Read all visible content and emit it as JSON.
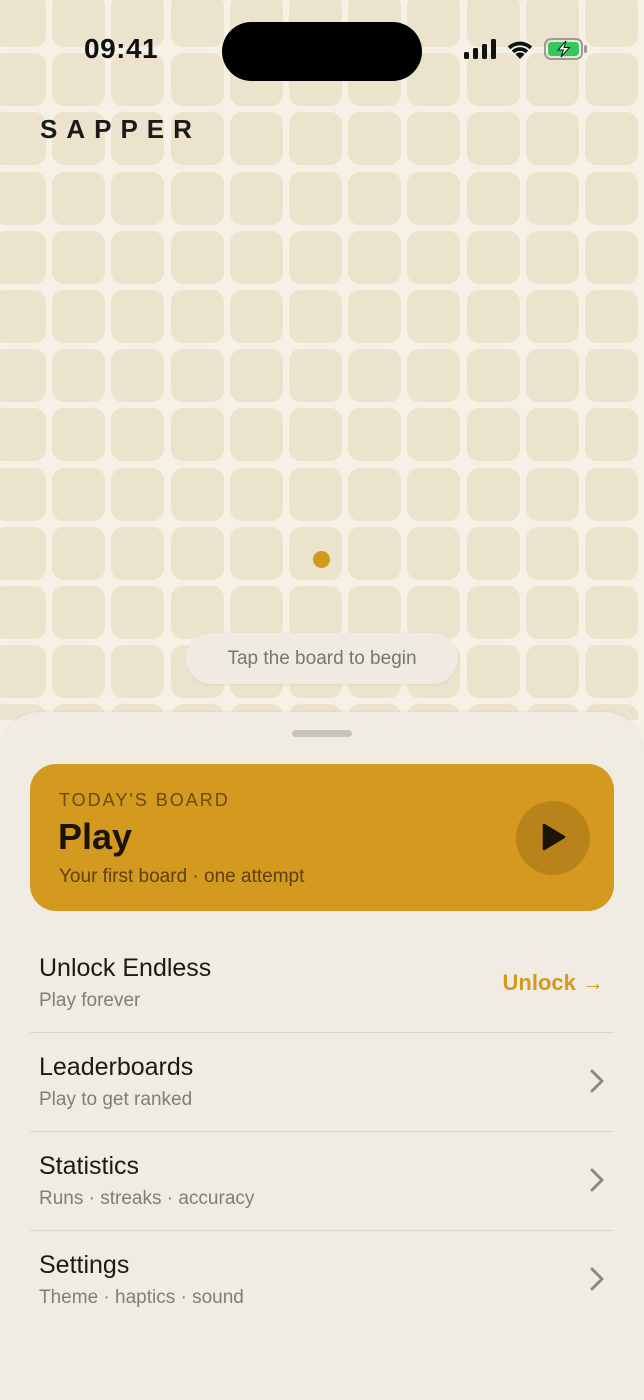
{
  "status_bar": {
    "time": "09:41",
    "icons": [
      "signal-icon",
      "wifi-icon",
      "battery-charging-icon"
    ],
    "battery_color": "#34c759"
  },
  "header": {
    "brand": "SAPPER"
  },
  "board": {
    "hint": "Tap the board to begin",
    "accent": "#d4981e"
  },
  "today_card": {
    "eyebrow": "TODAY'S BOARD",
    "title": "Play",
    "subtitle": "Your first board · one attempt",
    "play_icon": "play-icon",
    "color": "#d4991f"
  },
  "menu": {
    "items": [
      {
        "title": "Unlock Endless",
        "subtitle": "Play forever",
        "action": "Unlock →"
      },
      {
        "title": "Leaderboards",
        "subtitle": "Play to get ranked"
      },
      {
        "title": "Statistics",
        "subtitle": "Runs · streaks · accuracy"
      },
      {
        "title": "Settings",
        "subtitle": "Theme · haptics · sound"
      }
    ]
  }
}
